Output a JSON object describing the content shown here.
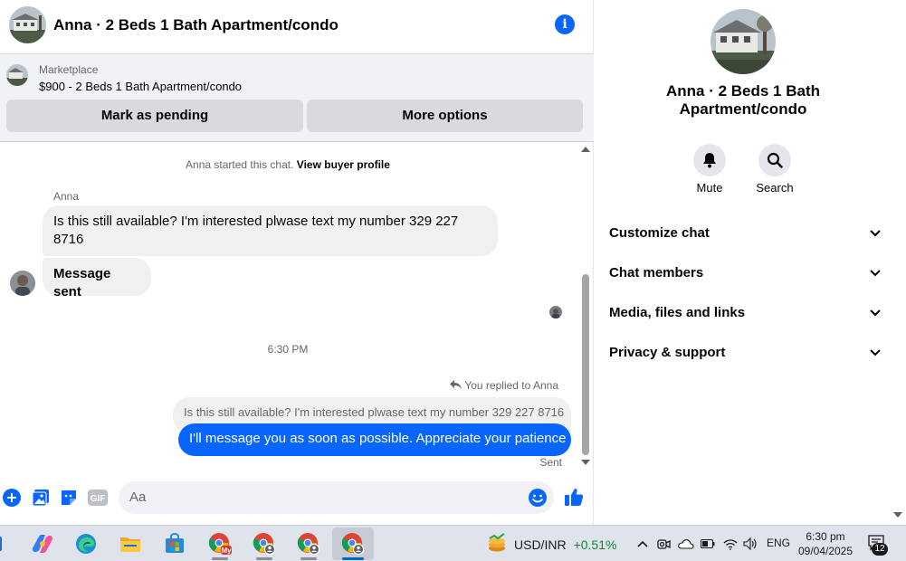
{
  "chat": {
    "title": "Anna · 2 Beds 1 Bath Apartment/condo",
    "info_icon": "info-icon"
  },
  "marketplace": {
    "label": "Marketplace",
    "listing": "$900 - 2 Beds 1 Bath Apartment/condo",
    "mark_pending_label": "Mark as pending",
    "more_options_label": "More options"
  },
  "messages": {
    "system_text": "Anna started this chat.",
    "view_profile_link": "View buyer profile",
    "sender_name": "Anna",
    "incoming": [
      "Is this still available? I'm interested plwase text my number 329 227 8716",
      "Message sent"
    ],
    "timestamp": "6:30 PM",
    "replied_to": "You replied to Anna",
    "quoted_text": "Is this still available? I'm interested plwase text my number 329 227 8716",
    "outgoing": "I'll message you as soon as possible. Appreciate your patience",
    "status": "Sent"
  },
  "composer": {
    "placeholder": "Aa",
    "icons": [
      "plus-icon",
      "photo-icon",
      "sticker-icon",
      "gif-icon",
      "emoji-icon",
      "like-icon"
    ],
    "gif_label": "GIF"
  },
  "sidebar": {
    "title": "Anna · 2 Beds 1 Bath Apartment/condo",
    "actions": [
      {
        "label": "Mute",
        "icon": "bell-icon"
      },
      {
        "label": "Search",
        "icon": "search-icon"
      }
    ],
    "sections": [
      {
        "label": "Customize chat"
      },
      {
        "label": "Chat members"
      },
      {
        "label": "Media, files and links"
      },
      {
        "label": "Privacy & support"
      }
    ]
  },
  "taskbar": {
    "apps": [
      "copilot-icon",
      "edge-icon",
      "file-explorer-icon",
      "store-icon",
      "chrome-icon",
      "chrome-icon",
      "chrome-icon",
      "chrome-icon"
    ],
    "ticker_symbol": "USD/INR",
    "ticker_change": "+0.51%",
    "language": "ENG",
    "time": "6:30 pm",
    "date": "09/04/2025",
    "notification_count": "12"
  },
  "colors": {
    "accent": "#0866ff",
    "bubble_in": "#f0f0f0",
    "button_bg": "#d8dadf",
    "positive": "#0f8a2d"
  }
}
